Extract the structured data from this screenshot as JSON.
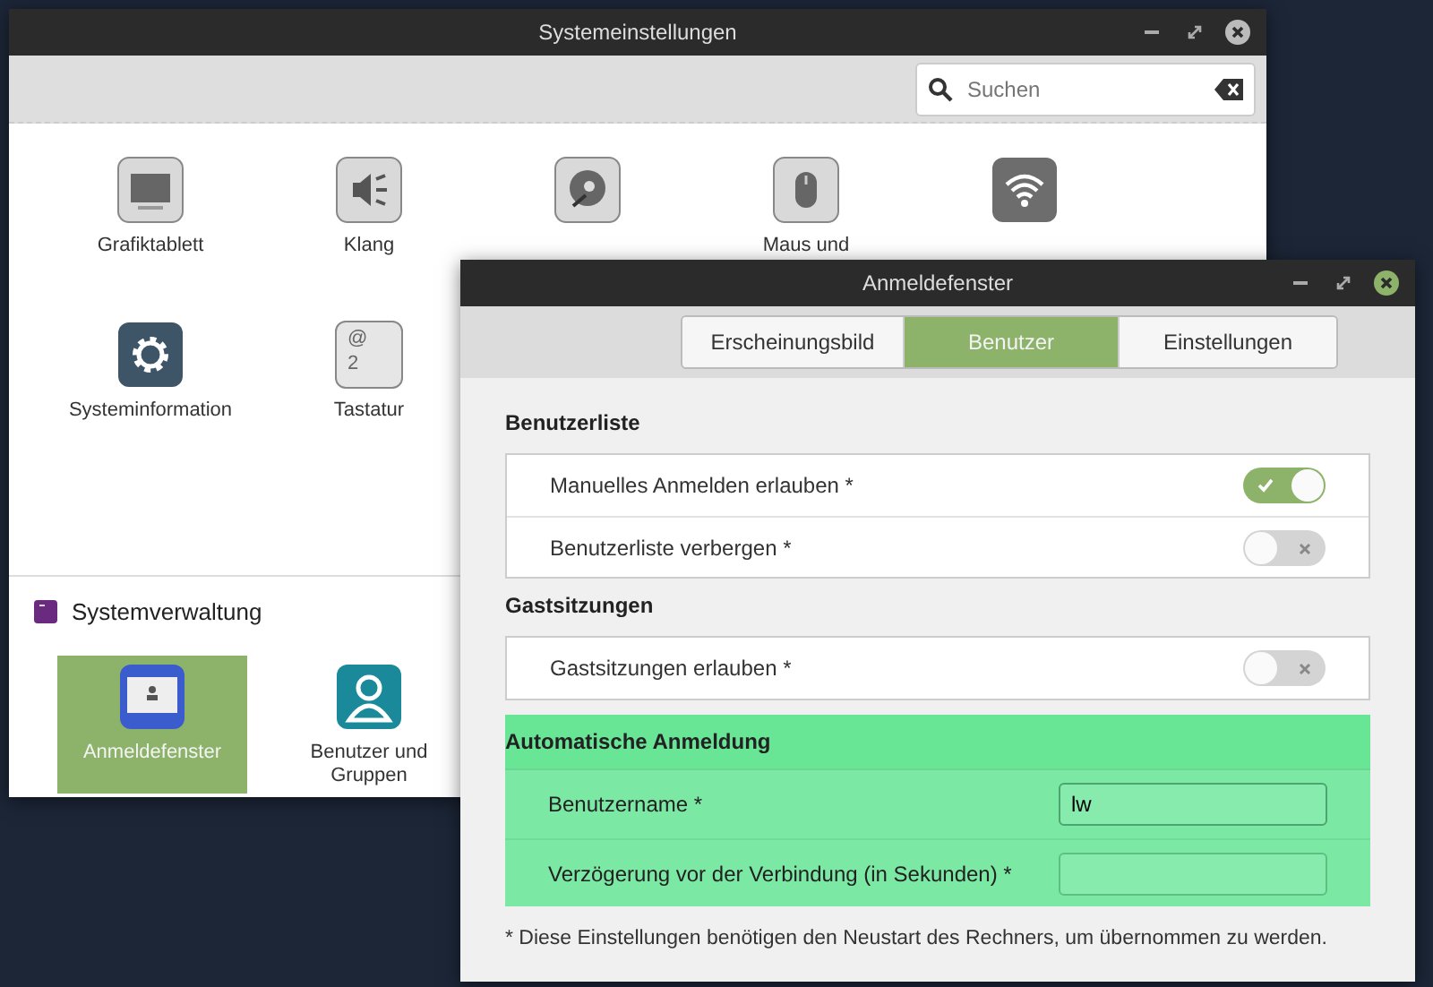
{
  "settings_window": {
    "title": "Systemeinstellungen",
    "search": {
      "placeholder": "Suchen"
    },
    "items": [
      {
        "kind": "labeled",
        "label": "Grafiktablett"
      },
      {
        "kind": "labeled",
        "label": "Klang"
      },
      {
        "kind": "icon_only"
      },
      {
        "kind": "labeled",
        "label": "Maus und"
      },
      {
        "kind": "icon_only"
      },
      {
        "kind": "labeled",
        "label": "Systeminformation"
      },
      {
        "kind": "labeled",
        "label": "Tastatur",
        "key_labels": [
          "@",
          "2"
        ]
      }
    ],
    "section": {
      "title": "Systemverwaltung",
      "items": [
        {
          "label": "Anmeldefenster",
          "selected": true
        },
        {
          "label": "Benutzer und Gruppen",
          "selected": false
        }
      ]
    }
  },
  "login_window": {
    "title": "Anmeldefenster",
    "tabs": [
      {
        "label": "Erscheinungsbild",
        "selected": false
      },
      {
        "label": "Benutzer",
        "selected": true
      },
      {
        "label": "Einstellungen",
        "selected": false
      }
    ],
    "sections": [
      {
        "title": "Benutzerliste",
        "highlighted": false,
        "rows": [
          {
            "kind": "switch",
            "label": "Manuelles Anmelden erlauben *",
            "on": true
          },
          {
            "kind": "switch",
            "label": "Benutzerliste verbergen *",
            "on": false
          }
        ]
      },
      {
        "title": "Gastsitzungen",
        "highlighted": false,
        "rows": [
          {
            "kind": "switch",
            "label": "Gastsitzungen erlauben *",
            "on": false
          }
        ]
      },
      {
        "title": "Automatische Anmeldung",
        "highlighted": true,
        "rows": [
          {
            "kind": "field",
            "label": "Benutzername *",
            "value": "lw"
          },
          {
            "kind": "field",
            "label": "Verzögerung vor der Verbindung (in Sekunden) *"
          }
        ]
      }
    ],
    "note": "* Diese Einstellungen benötigen den Neustart des Rechners, um übernommen zu werden."
  }
}
